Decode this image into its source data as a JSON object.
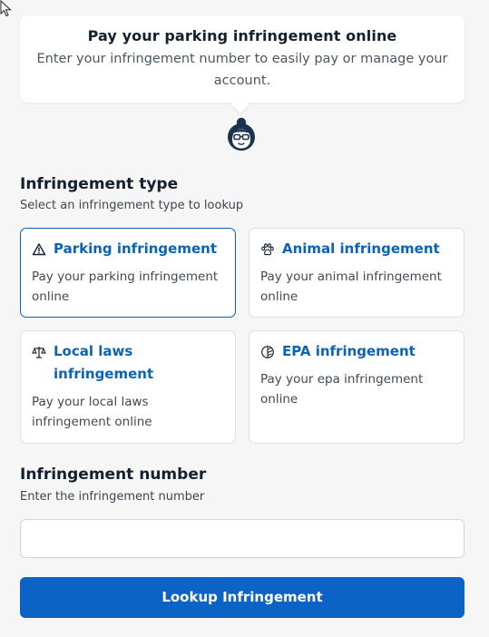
{
  "banner": {
    "title": "Pay your parking infringement online",
    "subtitle": "Enter your infringement number to easily pay or manage your account."
  },
  "avatar_icon": "woman-with-glasses-icon",
  "type_section": {
    "title": "Infringement type",
    "subtitle": "Select an infringement type to lookup"
  },
  "types": [
    {
      "icon": "warning-triangle-icon",
      "title": "Parking infringement",
      "description": "Pay your parking infringement online",
      "selected": true
    },
    {
      "icon": "paw-icon",
      "title": "Animal infringement",
      "description": "Pay your animal infringement online",
      "selected": false
    },
    {
      "icon": "scales-icon",
      "title": "Local laws infringement",
      "description": "Pay your local laws infringement online",
      "selected": false
    },
    {
      "icon": "leaf-icon",
      "title": "EPA infringement",
      "description": "Pay your epa infringement online",
      "selected": false
    }
  ],
  "number_section": {
    "title": "Infringement number",
    "subtitle": "Enter the infringement number",
    "value": "",
    "placeholder": ""
  },
  "submit_label": "Lookup Infringement",
  "colors": {
    "accent": "#0b63c6",
    "link": "#0b63b9",
    "background": "#f6f6f6"
  }
}
